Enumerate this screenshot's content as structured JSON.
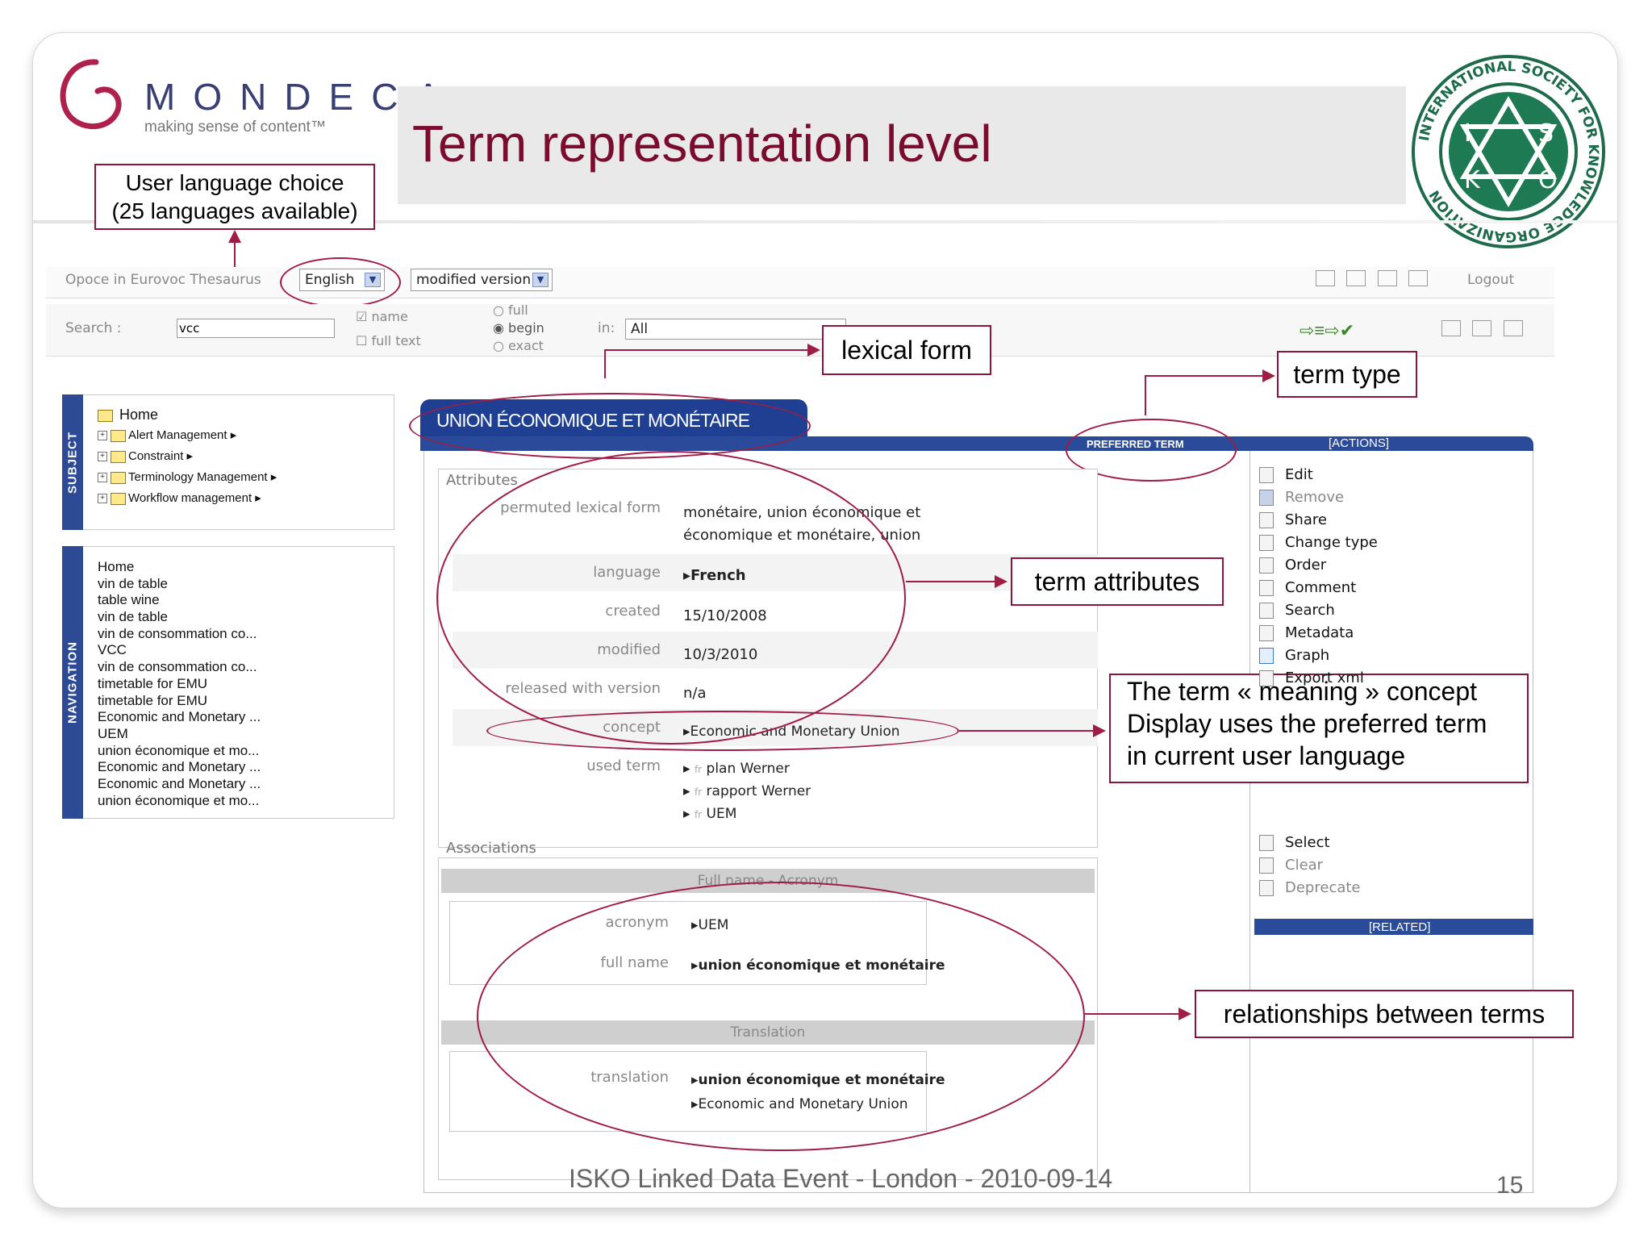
{
  "header": {
    "logo_word": "MONDECA",
    "logo_tagline": "making sense of content™",
    "title": "Term representation level",
    "seal_text": "INTERNATIONAL SOCIETY FOR KNOWLEDGE ORGANIZATION",
    "seal_letters": [
      "I",
      "S",
      "K",
      "O"
    ]
  },
  "callouts": {
    "language": [
      "User language choice",
      "(25 languages available)"
    ],
    "lexical": "lexical form",
    "term_type": "term type",
    "term_attributes": "term attributes",
    "meaning": [
      "The term « meaning » concept",
      "Display uses the preferred term",
      "in current user language"
    ],
    "relationships": "relationships between terms"
  },
  "toolbar": {
    "breadcrumb_prefix": "Opoce in Eurovoc Thesaurus",
    "language": "English",
    "version": "modified version",
    "logout": "Logout"
  },
  "search": {
    "label": "Search :",
    "value": "vcc",
    "opt_name": "name",
    "opt_fulltext": "full text",
    "opt_full": "full",
    "opt_begin": "begin",
    "opt_exact": "exact",
    "in_label": "in:",
    "in_value": "All"
  },
  "subject": {
    "tab": "SUBJECT",
    "home": "Home",
    "items": [
      "Alert Management",
      "Constraint",
      "Terminology Management",
      "Workflow management"
    ]
  },
  "navigation": {
    "tab": "NAVIGATION",
    "items": [
      "Home",
      "vin de table",
      "table wine",
      "vin de table",
      "vin de consommation co...",
      "VCC",
      "vin de consommation co...",
      "timetable for EMU",
      "timetable for EMU",
      "Economic and Monetary ...",
      "UEM",
      "union économique et mo...",
      "Economic and Monetary ...",
      "Economic and Monetary ...",
      "union économique et mo..."
    ]
  },
  "term": {
    "name": "UNION ÉCONOMIQUE ET MONÉTAIRE",
    "type": "PREFERRED TERM",
    "actions_header": "[ACTIONS]",
    "related_header": "[RELATED]",
    "attributes_title": "Attributes",
    "attributes": {
      "permuted_label": "permuted lexical form",
      "permuted_line1": "monétaire, union économique et",
      "permuted_line2": "économique et monétaire, union",
      "language_label": "language",
      "language_value": "French",
      "created_label": "created",
      "created_value": "15/10/2008",
      "modified_label": "modified",
      "modified_value": "10/3/2010",
      "released_label": "released with version",
      "released_value": "n/a",
      "concept_label": "concept",
      "concept_value": "Economic and Monetary Union",
      "used_label": "used term",
      "lang_prefix": "fr",
      "used": [
        "plan Werner",
        "rapport Werner",
        "UEM"
      ]
    },
    "associations_title": "Associations",
    "full_name_band": "Full name - Acronym",
    "acronym_label": "acronym",
    "acronym_value": "UEM",
    "fullname_label": "full name",
    "fullname_value": "union économique et monétaire",
    "translation_band": "Translation",
    "translation_label": "translation",
    "translation_values": [
      "union économique et monétaire",
      "Economic and Monetary Union"
    ]
  },
  "actions": {
    "items": [
      {
        "label": "Edit",
        "enabled": true
      },
      {
        "label": "Remove",
        "enabled": false
      },
      {
        "label": "Share",
        "enabled": true
      },
      {
        "label": "Change type",
        "enabled": true
      },
      {
        "label": "Order",
        "enabled": true
      },
      {
        "label": "Comment",
        "enabled": true
      },
      {
        "label": "Search",
        "enabled": true
      },
      {
        "label": "Metadata",
        "enabled": true
      },
      {
        "label": "Graph",
        "enabled": true
      },
      {
        "label": "Export xml",
        "enabled": true
      }
    ],
    "lower": [
      {
        "label": "Select",
        "enabled": true
      },
      {
        "label": "Clear",
        "enabled": false
      },
      {
        "label": "Deprecate",
        "enabled": false
      }
    ]
  },
  "footer": {
    "text": "ISKO Linked Data Event - London - 2010-09-14",
    "page": "15"
  },
  "colors": {
    "accent": "#8a1538",
    "title": "#7a0c2e",
    "ui_blue": "#2a4a9a"
  }
}
